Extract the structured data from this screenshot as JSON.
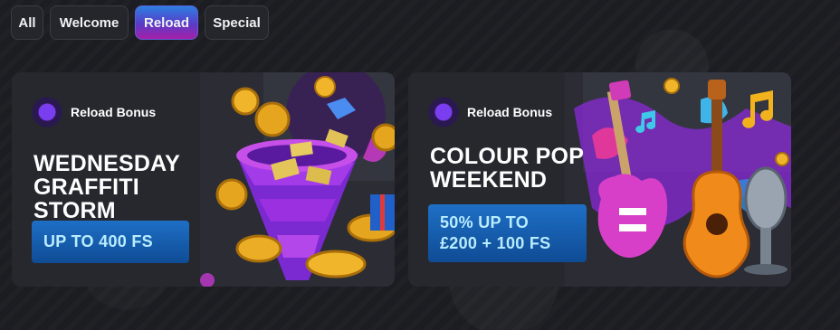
{
  "filters": [
    {
      "label": "All",
      "active": false
    },
    {
      "label": "Welcome",
      "active": false
    },
    {
      "label": "Reload",
      "active": true
    },
    {
      "label": "Special",
      "active": false
    }
  ],
  "promotions": [
    {
      "badge": "Reload Bonus",
      "title_lines": [
        "WEDNESDAY",
        "GRAFFITI STORM"
      ],
      "offer_lines": [
        "UP TO 400 FS"
      ],
      "art": "coin-tornado-illustration"
    },
    {
      "badge": "Reload Bonus",
      "title_lines": [
        "COLOUR POP",
        "WEEKEND"
      ],
      "offer_lines": [
        "50% UP TO",
        "£200 + 100 FS"
      ],
      "art": "guitars-microphone-illustration"
    }
  ],
  "colors": {
    "background": "#1c1d22",
    "card": "#26282e",
    "active_chip_gradient": [
      "#2d7fe0",
      "#a61fa6"
    ],
    "offer_button": "#1e6fc6",
    "offer_text": "#b8ecff"
  }
}
